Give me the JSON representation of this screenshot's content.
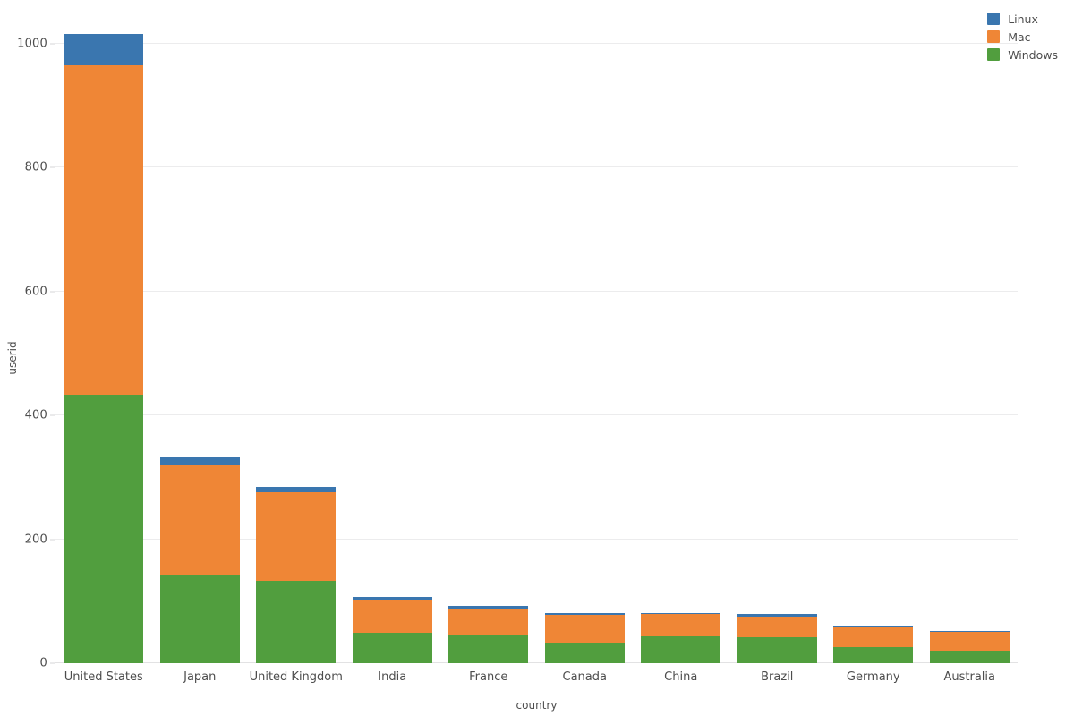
{
  "chart_data": {
    "type": "bar",
    "subtype": "stacked-vertical-bar",
    "title": "",
    "xlabel": "country",
    "ylabel": "userid",
    "categories": [
      "United States",
      "Japan",
      "United Kingdom",
      "India",
      "France",
      "Canada",
      "China",
      "Brazil",
      "Germany",
      "Australia"
    ],
    "series": [
      {
        "name": "Windows",
        "color": "#519e3e",
        "values": [
          433,
          143,
          133,
          49,
          45,
          33,
          43,
          42,
          26,
          20
        ]
      },
      {
        "name": "Mac",
        "color": "#ef8636",
        "values": [
          532,
          178,
          143,
          54,
          41,
          45,
          36,
          33,
          32,
          30
        ]
      },
      {
        "name": "Linux",
        "color": "#3a76af",
        "values": [
          50,
          11,
          9,
          4,
          7,
          3,
          2,
          5,
          3,
          2
        ]
      }
    ],
    "stack_order_bottom_to_top": [
      "Windows",
      "Mac",
      "Linux"
    ],
    "totals": [
      1015,
      332,
      285,
      107,
      93,
      81,
      81,
      80,
      61,
      52
    ],
    "ylim": [
      0,
      1050
    ],
    "yticks": [
      0,
      200,
      400,
      600,
      800,
      1000
    ],
    "ytick_labels": [
      "0",
      "200",
      "400",
      "600",
      "800",
      "1000"
    ],
    "grid": true,
    "grid_axis": "y",
    "legend_position": "top-right",
    "legend_entries": [
      "Linux",
      "Mac",
      "Windows"
    ],
    "background_color": "#ffffff",
    "gridline_color": "#ececed",
    "text_color": "#4d4d4d"
  },
  "legend": {
    "items": [
      {
        "label": "Linux",
        "color": "#3a76af"
      },
      {
        "label": "Mac",
        "color": "#ef8636"
      },
      {
        "label": "Windows",
        "color": "#519e3e"
      }
    ]
  },
  "axes": {
    "y_title": "userid",
    "x_title": "country"
  }
}
